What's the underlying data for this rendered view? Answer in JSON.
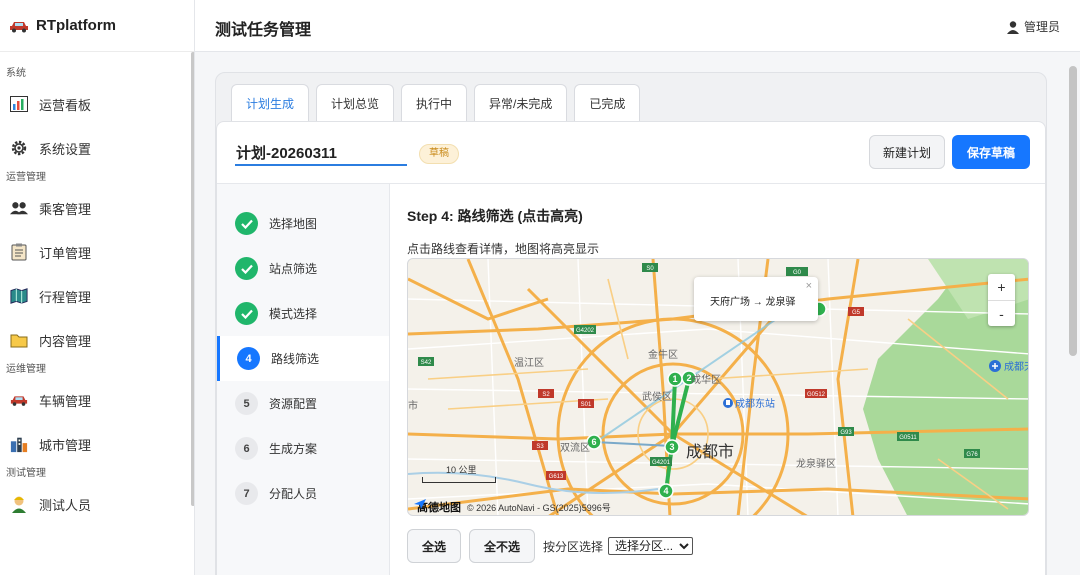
{
  "brand": {
    "name": "RTplatform"
  },
  "header": {
    "title": "测试任务管理",
    "user": "管理员"
  },
  "sidebar": {
    "groups": [
      {
        "label": "系统",
        "items": [
          {
            "label": "运营看板",
            "icon": "chart-icon"
          },
          {
            "label": "系统设置",
            "icon": "gear-icon"
          }
        ]
      },
      {
        "label": "运营管理",
        "items": [
          {
            "label": "乘客管理",
            "icon": "users-icon"
          },
          {
            "label": "订单管理",
            "icon": "clipboard-icon"
          },
          {
            "label": "行程管理",
            "icon": "map-book-icon"
          },
          {
            "label": "内容管理",
            "icon": "folder-icon"
          }
        ]
      },
      {
        "label": "运维管理",
        "items": [
          {
            "label": "车辆管理",
            "icon": "car-icon"
          },
          {
            "label": "城市管理",
            "icon": "city-icon"
          }
        ]
      },
      {
        "label": "测试管理",
        "items": [
          {
            "label": "测试人员",
            "icon": "person-icon"
          }
        ]
      }
    ]
  },
  "tabs": [
    "计划生成",
    "计划总览",
    "执行中",
    "异常/未完成",
    "已完成"
  ],
  "active_tab": "计划生成",
  "plan": {
    "name": "计划-20260311",
    "status_badge": "草稿",
    "new_button": "新建计划",
    "save_button": "保存草稿"
  },
  "steps": [
    {
      "num": "1",
      "label": "选择地图",
      "state": "done"
    },
    {
      "num": "2",
      "label": "站点筛选",
      "state": "done"
    },
    {
      "num": "3",
      "label": "模式选择",
      "state": "done"
    },
    {
      "num": "4",
      "label": "路线筛选",
      "state": "current"
    },
    {
      "num": "5",
      "label": "资源配置",
      "state": "todo"
    },
    {
      "num": "6",
      "label": "生成方案",
      "state": "todo"
    },
    {
      "num": "7",
      "label": "分配人员",
      "state": "todo"
    }
  ],
  "step_content": {
    "title": "Step 4: 路线筛选 (点击高亮)",
    "hint": "点击路线查看详情，地图将高亮显示"
  },
  "map": {
    "popup_text": "天府广场 → 龙泉驿",
    "popup_close": "×",
    "zoom_in": "+",
    "zoom_out": "-",
    "scale_label": "10 公里",
    "logo_text": "高德地图",
    "attribution": "© 2026 AutoNavi - GS(2025)5996号",
    "places": {
      "city": "成都市",
      "jinniu": "金牛区",
      "wenjiang": "温江区",
      "wuhou": "武侯区",
      "chenghua": "成华区",
      "shuangliu": "双流区",
      "longquanyi": "龙泉驿区",
      "chengdu_east": "成都东站",
      "airport": "成都天",
      "edge_left": "市"
    },
    "route_markers": [
      "1",
      "2",
      "3",
      "4",
      "6"
    ],
    "road_shields": [
      "S0",
      "G0",
      "G4202",
      "G4201",
      "G0511",
      "S42",
      "S01",
      "G0512",
      "G93",
      "G5",
      "G613",
      "G76",
      "S2",
      "S3"
    ],
    "colors": {
      "land": "#f4f1ea",
      "park": "#a9d99a",
      "major_road": "#f4b04a",
      "minor_road": "#ffffff",
      "water": "#aacfe6",
      "route": "#2fb04e",
      "route_link": "#8ec9e0"
    }
  },
  "actions": {
    "select_all": "全选",
    "select_none": "全不选",
    "district_label": "按分区选择",
    "district_select": "选择分区..."
  },
  "colors": {
    "accent": "#1677ff",
    "done": "#20b66b",
    "badge_bg": "#fdf1d8"
  }
}
